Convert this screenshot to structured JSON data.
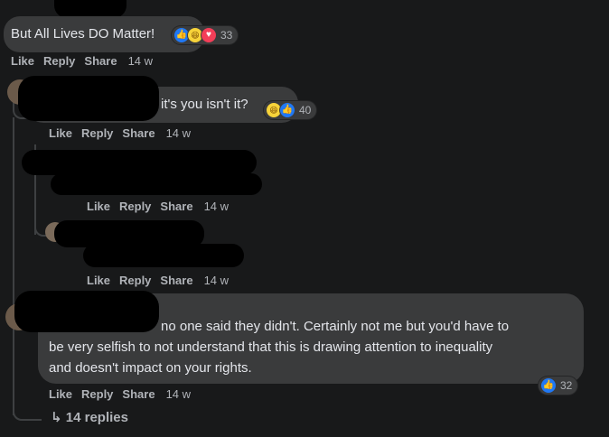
{
  "comments": [
    {
      "text": "But All Lives DO Matter!",
      "reactions": [
        "like-icon",
        "haha-icon",
        "love-icon"
      ],
      "reaction_count": "33",
      "actions": {
        "like": "Like",
        "reply": "Reply",
        "share": "Share",
        "time": "14 w"
      }
    },
    {
      "text": "it's you isn't it?",
      "reactions": [
        "haha-icon",
        "like-icon"
      ],
      "reaction_count": "40",
      "actions": {
        "like": "Like",
        "reply": "Reply",
        "share": "Share",
        "time": "14 w"
      }
    },
    {
      "text": "",
      "actions": {
        "like": "Like",
        "reply": "Reply",
        "share": "Share",
        "time": "14 w"
      }
    },
    {
      "text": "",
      "actions": {
        "like": "Like",
        "reply": "Reply",
        "share": "Share",
        "time": "14 w"
      }
    },
    {
      "text_line1": "no one said they didn't. Certainly not me but you'd have to",
      "text_line2": "be very selfish to not understand that this is drawing attention to inequality",
      "text_line3": "and doesn't impact on your rights.",
      "reactions": [
        "like-icon"
      ],
      "reaction_count": "32",
      "actions": {
        "like": "Like",
        "reply": "Reply",
        "share": "Share",
        "time": "14 w"
      }
    }
  ],
  "replies_link": "14 replies",
  "colors": {
    "background": "#18191a",
    "bubble": "#3a3b3c",
    "like": "#2078f4",
    "love": "#f33e58",
    "haha": "#f7d33a"
  }
}
